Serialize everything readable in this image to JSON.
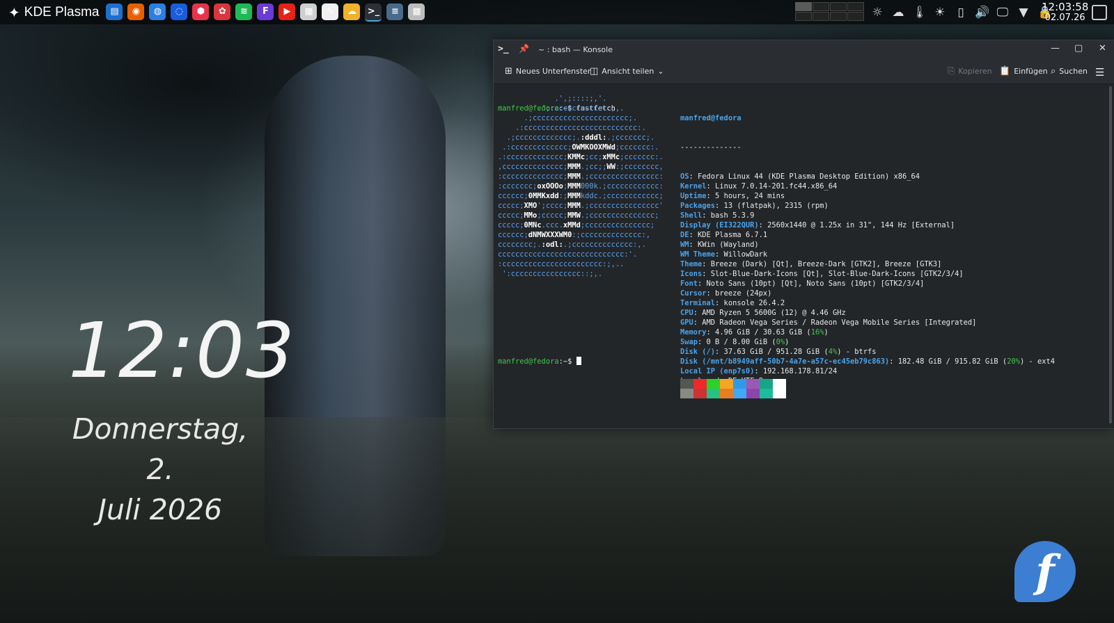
{
  "panel": {
    "launcher_label": "KDE Plasma",
    "tasks": [
      {
        "name": "dolphin-icon",
        "glyph": "▤",
        "color": "#1d6fcf"
      },
      {
        "name": "firefox-icon",
        "glyph": "◉",
        "color": "#e66000"
      },
      {
        "name": "thunderbird-icon",
        "glyph": "◍",
        "color": "#2a7fe3"
      },
      {
        "name": "bitwarden-icon",
        "glyph": "◌",
        "color": "#175ddc"
      },
      {
        "name": "package-icon",
        "glyph": "⬢",
        "color": "#e8334a"
      },
      {
        "name": "settings-app-icon",
        "glyph": "✿",
        "color": "#d9363e"
      },
      {
        "name": "spotify-icon",
        "glyph": "≋",
        "color": "#1db954"
      },
      {
        "name": "fp-app-icon",
        "glyph": "F",
        "color": "#6a3bd6"
      },
      {
        "name": "youtube-icon",
        "glyph": "▶",
        "color": "#e62117"
      },
      {
        "name": "calendar-icon",
        "glyph": "▦",
        "color": "#cfcfcf"
      },
      {
        "name": "document-icon",
        "glyph": "✎",
        "color": "#f0f0f0"
      },
      {
        "name": "weather-app-icon",
        "glyph": "☁",
        "color": "#f2b12b"
      },
      {
        "name": "konsole-icon",
        "glyph": ">_",
        "color": "#2d3035"
      },
      {
        "name": "system-monitor-icon",
        "glyph": "≡",
        "color": "#4a6a8a"
      },
      {
        "name": "calculator-icon",
        "glyph": "▩",
        "color": "#bdbdbd"
      }
    ],
    "tray": [
      {
        "name": "weather-icon",
        "glyph": "☼"
      },
      {
        "name": "cloud-sync-icon",
        "glyph": "☁"
      },
      {
        "name": "temperature-icon",
        "glyph": "🌡"
      },
      {
        "name": "brightness-icon",
        "glyph": "☀"
      },
      {
        "name": "battery-icon",
        "glyph": "▯"
      },
      {
        "name": "volume-icon",
        "glyph": "🔊"
      },
      {
        "name": "display-icon",
        "glyph": "🖵"
      },
      {
        "name": "network-icon",
        "glyph": "▼"
      },
      {
        "name": "lock-icon",
        "glyph": "🔒"
      }
    ],
    "clock_time": "12:03:58",
    "clock_date": "02.07.26"
  },
  "desktop": {
    "clock": "12:03",
    "date_line1": "Donnerstag, 2.",
    "date_line2": "Juli 2026"
  },
  "konsole": {
    "title": "~ : bash — Konsole",
    "toolbar": {
      "new_tab": "Neues Unterfenster",
      "split_view": "Ansicht teilen",
      "copy": "Kopieren",
      "paste": "Einfügen",
      "search": "Suchen"
    },
    "prompt_user": "manfred@fedora",
    "prompt_suffix": ":~$ ",
    "command": "fastfetch",
    "header_user": "manfred@fedora",
    "separator": "--------------",
    "info": [
      {
        "key": "OS",
        "value": ": Fedora Linux 44 (KDE Plasma Desktop Edition) x86_64"
      },
      {
        "key": "Kernel",
        "value": ": Linux 7.0.14-201.fc44.x86_64"
      },
      {
        "key": "Uptime",
        "value": ": 5 hours, 24 mins"
      },
      {
        "key": "Packages",
        "value": ": 13 (flatpak), 2315 (rpm)"
      },
      {
        "key": "Shell",
        "value": ": bash 5.3.9"
      },
      {
        "key": "Display (EI322QUR)",
        "value": ": 2560x1440 @ 1.25x in 31\", 144 Hz [External]"
      },
      {
        "key": "DE",
        "value": ": KDE Plasma 6.7.1"
      },
      {
        "key": "WM",
        "value": ": KWin (Wayland)"
      },
      {
        "key": "WM Theme",
        "value": ": WillowDark"
      },
      {
        "key": "Theme",
        "value": ": Breeze (Dark) [Qt], Breeze-Dark [GTK2], Breeze [GTK3]"
      },
      {
        "key": "Icons",
        "value": ": Slot-Blue-Dark-Icons [Qt], Slot-Blue-Dark-Icons [GTK2/3/4]"
      },
      {
        "key": "Font",
        "value": ": Noto Sans (10pt) [Qt], Noto Sans (10pt) [GTK2/3/4]"
      },
      {
        "key": "Cursor",
        "value": ": breeze (24px)"
      },
      {
        "key": "Terminal",
        "value": ": konsole 26.4.2"
      },
      {
        "key": "CPU",
        "value": ": AMD Ryzen 5 5600G (12) @ 4.46 GHz"
      },
      {
        "key": "GPU",
        "value": ": AMD Radeon Vega Series / Radeon Vega Mobile Series [Integrated]"
      },
      {
        "key": "Memory",
        "value": ": 4.96 GiB / 30.63 GiB (",
        "pct": "16%",
        "tail": ")"
      },
      {
        "key": "Swap",
        "value": ": 0 B / 8.00 GiB (",
        "pct": "0%",
        "tail": ")"
      },
      {
        "key": "Disk (/)",
        "value": ": 37.63 GiB / 951.28 GiB (",
        "pct": "4%",
        "tail": ") - btrfs"
      },
      {
        "key": "Disk (/mnt/b8949aff-50b7-4a7e-a57c-ec45eb79c863)",
        "value": ": 182.48 GiB / 915.82 GiB (",
        "pct": "20%",
        "tail": ") - ext4"
      },
      {
        "key": "Local IP (enp7s0)",
        "value": ": 192.168.178.81/24"
      },
      {
        "key": "Locale",
        "value": ": de_DE.UTF-8"
      }
    ],
    "logo_lines": [
      "             .',;::::;,'.",
      "         .';:cccccccccccc:;,.",
      "      .;cccccccccccccccccccccc;.",
      "    .:cccccccccccccccccccccccccc:.",
      "  .;ccccccccccccc;.:dddl:.;ccccccc;.",
      " .:ccccccccccccc;OWMKOOXMWd;ccccccc:.",
      ".:ccccccccccccc;KMMc;cc;xMMc;ccccccc:.",
      ",cccccccccccccc;MMM.;cc;;WW:;cccccccc,",
      ":cccccccccccccc;MMM.;cccccccccccccccc:",
      ":ccccccc;oxOOOo;MMM000k.;cccccccccccc:",
      "cccccc;0MMKxdd:;MMMkddc.;cccccccccccc;",
      "ccccc;XMO';cccc;MMM.;cccccccccccccccc'",
      "ccccc;MMo;ccccc;MMW.;ccccccccccccccc;",
      "ccccc;0MNc.ccc.xMMd;ccccccccccccccc;",
      "cccccc;dNMWXXXWM0:;cccccccccccccc:,",
      "cccccccc;.:odl:.;cccccccccccccc:,.",
      "ccccccccccccccccccccccccccccc:'.",
      ":ccccccccccccccccccccccc:;,..",
      " ':cccccccccccccccc::;,."
    ],
    "palette_top": [
      "#555753",
      "#ef2929",
      "#2ad22a",
      "#f5a623",
      "#2f9ae8",
      "#9b59b6",
      "#17a589",
      "#ffffff"
    ],
    "palette_bottom": [
      "#888a85",
      "#cc3333",
      "#26c281",
      "#e67e22",
      "#3fa9f5",
      "#8e44ad",
      "#1abc9c",
      "#ffffff"
    ]
  }
}
